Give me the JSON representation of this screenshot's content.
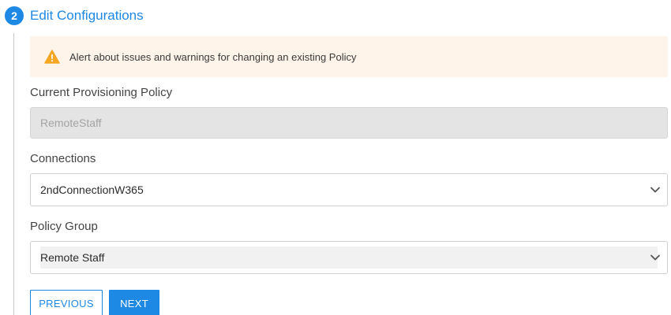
{
  "step": {
    "number": "2",
    "title": "Edit Configurations"
  },
  "alert": {
    "icon": "warning-triangle-icon",
    "text": "Alert about issues and warnings for changing an existing Policy",
    "icon_color": "#f5a623",
    "background": "#fff4ea"
  },
  "fields": {
    "current_policy": {
      "label": "Current Provisioning Policy",
      "value": "RemoteStaff"
    },
    "connections": {
      "label": "Connections",
      "selected": "2ndConnectionW365"
    },
    "policy_group": {
      "label": "Policy Group",
      "selected": "Remote Staff"
    }
  },
  "buttons": {
    "previous": "PREVIOUS",
    "next": "NEXT"
  },
  "colors": {
    "accent": "#1e88e5"
  }
}
